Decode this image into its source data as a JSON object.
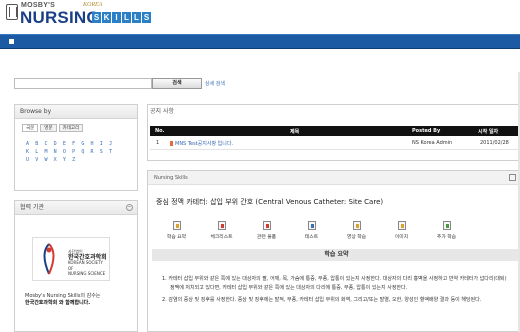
{
  "header": {
    "logo_mosbys": "MOSBY'S",
    "logo_korea": "KOREA",
    "logo_nursing": "NURSING",
    "logo_skills_letters": [
      "S",
      "K",
      "I",
      "L",
      "L",
      "S"
    ]
  },
  "search": {
    "placeholder": "",
    "button_label": "검색",
    "detail_link": "상세 검색"
  },
  "browse": {
    "title": "Browse by",
    "tabs": [
      "국문",
      "영문",
      "카테고리"
    ],
    "alphabet_rows": [
      "A B C D E F G H I J",
      "K L M N O P Q R S T",
      "U V W X Y Z"
    ]
  },
  "partners": {
    "title": "협력 기관",
    "logo_line1": "사단법인",
    "logo_line2": "한국간호과학회",
    "logo_line3": "KOREAN SOCIETY OF",
    "logo_line4": "NURSING SCIENCE",
    "caption_line1": "Mosby's Nursing Skills의 감수는",
    "caption_line2": "한국간호과학회 와 함께합니다."
  },
  "notice": {
    "title": "공지 사항",
    "columns": {
      "no": "No.",
      "subject": "제목",
      "posted_by": "Posted By",
      "date": "시작 일자"
    },
    "rows": [
      {
        "no": "1",
        "subject": "MNS Test공지사항 입니다.",
        "posted_by": "NS Korea Admin",
        "date": "2011/02/28"
      }
    ]
  },
  "skills": {
    "section_label": "Nursing Skills",
    "topic_title": "중심 정맥 카테터: 삽입 부위 간호 (Central Venous Catheter: Site Care)",
    "subtabs": [
      {
        "label": "학습 요약",
        "icon": "summary-icon"
      },
      {
        "label": "체크리스트",
        "icon": "checklist-icon"
      },
      {
        "label": "관련 물품",
        "icon": "supplies-icon"
      },
      {
        "label": "테스트",
        "icon": "test-icon"
      },
      {
        "label": "영상 학습",
        "icon": "video-icon"
      },
      {
        "label": "이미지",
        "icon": "image-icon"
      },
      {
        "label": "추가 학습",
        "icon": "extra-study-icon"
      }
    ],
    "section_title": "학습 요약",
    "summary": [
      "1. 카테터 삽입 부위와 같은 쪽에 있는 대상자의 팔, 어깨, 목, 가슴에 통증, 부종, 압통이 있는지 사정한다. 대상자의 다리 흉벽을 사정하고 만약 카테터가 넙다리(대퇴) 정맥에 처치되고 있다면, 카테터 삽입 부위와 같은 쪽에 있는 대상자의 다리에 통증, 부종, 압통이 있는지 사정한다.",
      "2. 감염의 증상 및 징후를 사정한다. 증상 및 징후에는 발적, 부종, 카테터 삽입 부위의 화역, 그리고/또는 발열, 오한, 양성인 혈액배양 결과 등이 해당된다."
    ]
  },
  "colors": {
    "brand_blue": "#1b3f86",
    "nav_blue": "#1c5aa3",
    "skills_blue": "#2a7fc7",
    "link_blue": "#2f66b3"
  }
}
